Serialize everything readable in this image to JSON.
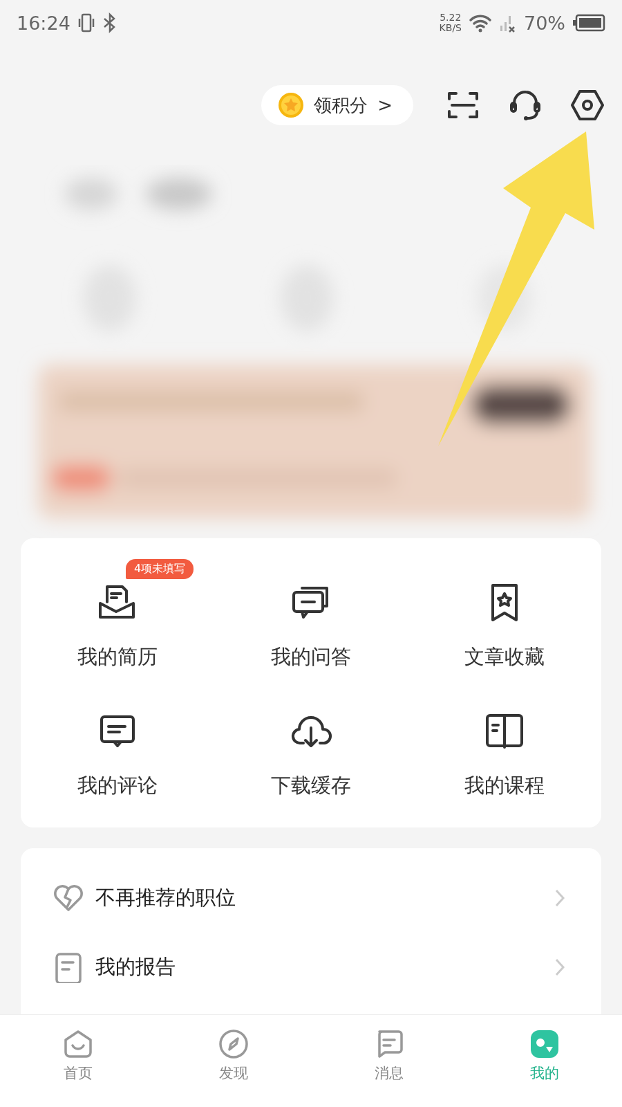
{
  "status_bar": {
    "time": "16:24",
    "speed": "5.22",
    "speed_unit": "KB/S",
    "battery": "70%"
  },
  "header": {
    "points_button": {
      "label": "领积分",
      "chevron": ">"
    }
  },
  "shortcuts": [
    {
      "label": "我的简历",
      "kind": "resume",
      "badge": "4项未填写"
    },
    {
      "label": "我的问答",
      "kind": "qa"
    },
    {
      "label": "文章收藏",
      "kind": "bookmark"
    },
    {
      "label": "我的评论",
      "kind": "comment"
    },
    {
      "label": "下载缓存",
      "kind": "download"
    },
    {
      "label": "我的课程",
      "kind": "book"
    }
  ],
  "menu": [
    {
      "label": "不再推荐的职位",
      "kind": "heart"
    },
    {
      "label": "我的报告",
      "kind": "report"
    }
  ],
  "tabs": [
    {
      "label": "首页",
      "kind": "home",
      "selected": false
    },
    {
      "label": "发现",
      "kind": "compass",
      "selected": false
    },
    {
      "label": "消息",
      "kind": "message",
      "selected": false
    },
    {
      "label": "我的",
      "kind": "me",
      "selected": true
    }
  ]
}
